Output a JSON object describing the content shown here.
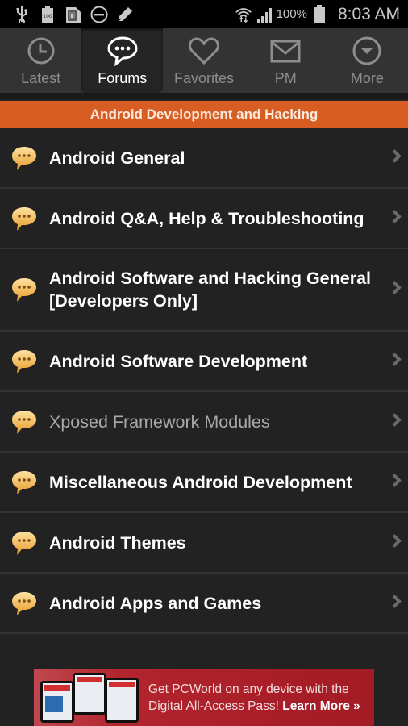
{
  "status_bar": {
    "left_icons": [
      "usb-icon",
      "battery-100-icon",
      "sd-card-icon",
      "do-not-disturb-icon",
      "pencil-icon"
    ],
    "right_icons": [
      "wifi-icon",
      "signal-icon",
      "battery-icon"
    ],
    "battery_text": "100%",
    "clock": "8:03 AM"
  },
  "tabs": [
    {
      "label": "Latest",
      "icon": "clock-icon",
      "active": false
    },
    {
      "label": "Forums",
      "icon": "chat-bubble-icon",
      "active": true
    },
    {
      "label": "Favorites",
      "icon": "heart-icon",
      "active": false
    },
    {
      "label": "PM",
      "icon": "envelope-icon",
      "active": false
    },
    {
      "label": "More",
      "icon": "more-dropdown-icon",
      "active": false
    }
  ],
  "section": {
    "title": "Android Development and Hacking",
    "color": "#d85d22"
  },
  "forums": [
    {
      "title": "Android General",
      "dim": false
    },
    {
      "title": "Android Q&A, Help & Troubleshooting",
      "dim": false
    },
    {
      "title": "Android Software and Hacking General [Developers Only]",
      "dim": false
    },
    {
      "title": "Android Software Development",
      "dim": false
    },
    {
      "title": "Xposed Framework Modules",
      "dim": true
    },
    {
      "title": "Miscellaneous Android Development",
      "dim": false
    },
    {
      "title": "Android Themes",
      "dim": false
    },
    {
      "title": "Android Apps and Games",
      "dim": false
    }
  ],
  "ad": {
    "line1": "Get PCWorld on any device with the",
    "line2": "Digital All-Access Pass!",
    "cta": "Learn More »",
    "brand": "PCWorld"
  }
}
